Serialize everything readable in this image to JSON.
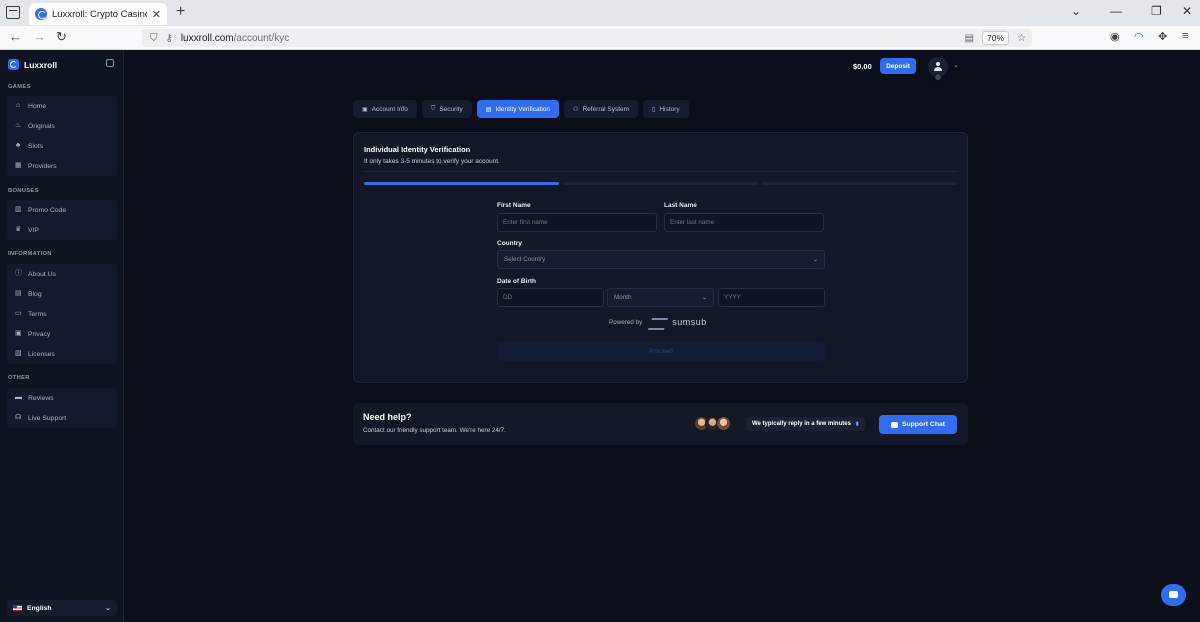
{
  "browser": {
    "tab_title": "Luxxroll: Crypto Casino Games",
    "url_host": "luxxroll.com",
    "url_path": "/account/kyc",
    "zoom": "70%"
  },
  "sidebar": {
    "logo": "Luxxroll",
    "sections": {
      "games": "GAMES",
      "bonuses": "BONUSES",
      "information": "INFORMATION",
      "other": "OTHER"
    },
    "games": [
      "Home",
      "Originals",
      "Slots",
      "Providers"
    ],
    "bonuses": [
      "Promo Code",
      "VIP"
    ],
    "information": [
      "About Us",
      "Blog",
      "Terms",
      "Privacy",
      "Licenses"
    ],
    "other": [
      "Reviews",
      "Live Support"
    ],
    "language": "English"
  },
  "header": {
    "balance": "$0.00",
    "deposit": "Deposit"
  },
  "tabs": [
    "Account Info",
    "Security",
    "Identity Verification",
    "Referral System",
    "History"
  ],
  "kyc": {
    "title": "Individual Identity Verification",
    "subtitle": "It only takes 3-5 minutes to verify your account.",
    "steps_total": 3,
    "step_current": 1,
    "first_name_label": "First Name",
    "first_name_placeholder": "Enter first name",
    "last_name_label": "Last Name",
    "last_name_placeholder": "Enter last name",
    "country_label": "Country",
    "country_placeholder": "Select Country",
    "dob_label": "Date of Birth",
    "day_placeholder": "DD",
    "month_placeholder": "Month",
    "year_placeholder": "YYYY",
    "powered_by": "Powered by",
    "provider": "sumsub",
    "proceed": "Proceed"
  },
  "help": {
    "title": "Need help?",
    "subtitle": "Contact our friendly support team. We're here 24/7.",
    "reply_time": "We typically reply in a few minutes",
    "support_button": "Support Chat"
  },
  "colors": {
    "accent": "#2f6df5",
    "background": "#0b0f19",
    "card": "#121826"
  }
}
